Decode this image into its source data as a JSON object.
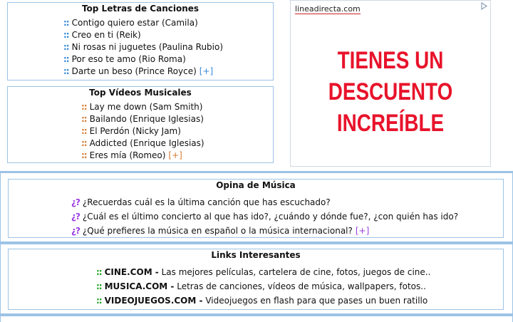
{
  "top_letras": {
    "title": "Top Letras de Canciones",
    "items": [
      "Contigo quiero estar (Camila)",
      "Creo en ti (Reik)",
      "Ni rosas ni juguetes (Paulina Rubio)",
      "Por eso te amo (Rio Roma)",
      "Darte un beso (Prince Royce)"
    ],
    "more": "[+]",
    "bullet": "::"
  },
  "top_videos": {
    "title": "Top Vídeos Musicales",
    "items": [
      "Lay me down (Sam Smith)",
      "Bailando (Enrique Iglesias)",
      "El Perdón (Nicky Jam)",
      "Addicted (Enrique Iglesias)",
      "Eres mía (Romeo)"
    ],
    "more": "[+]",
    "bullet": "::"
  },
  "ad": {
    "domain": "lineadirecta.com",
    "headline_lines": [
      "TIENES UN",
      "DESCUENTO",
      "INCREÍBLE"
    ],
    "icon": "ad-choices-icon"
  },
  "opina": {
    "title": "Opina de Música",
    "bullet": "¿?",
    "items": [
      "¿Recuerdas cuál es la última canción que has escuchado?",
      "¿Cuál es el último concierto al que has ido?, ¿cuándo y dónde fue?, ¿con quién has ido?",
      "¿Qué prefieres la música en español o la música internacional?"
    ],
    "more": "[+]"
  },
  "links": {
    "title": "Links Interesantes",
    "bullet": "::",
    "items": [
      {
        "name": "CINE.COM -",
        "desc": "Las mejores películas, cartelera de cine, fotos, juegos de cine.."
      },
      {
        "name": "MUSICA.COM -",
        "desc": "Letras de canciones, vídeos de música, wallpapers, fotos.."
      },
      {
        "name": "VIDEOJUEGOS.COM -",
        "desc": "Videojuegos en flash para que pases un buen ratillo"
      }
    ]
  },
  "colors": {
    "border": "#9cc3e6",
    "bullet_blue": "#2d85d6",
    "bullet_orange": "#d8792d",
    "bullet_purple": "#9b3ee0",
    "bullet_green": "#19a019",
    "ad_red": "#e8132b"
  }
}
